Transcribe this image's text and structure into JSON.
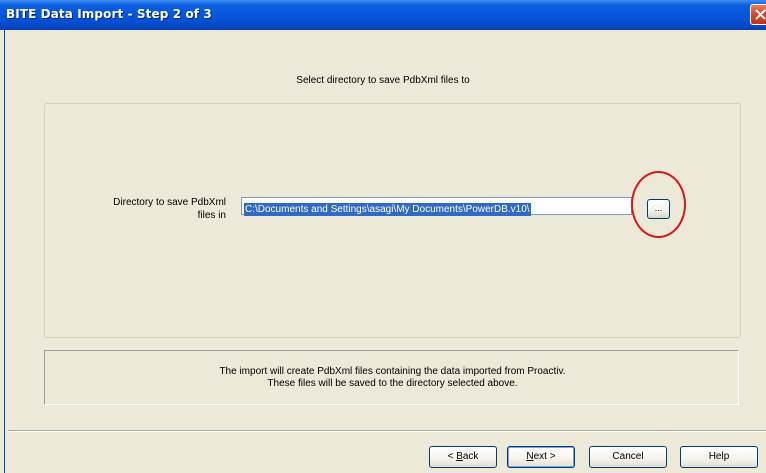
{
  "window": {
    "title": "BITE Data Import - Step 2 of 3"
  },
  "heading": "Select directory to save PdbXml files to",
  "directory": {
    "label_line1": "Directory to save PdbXml",
    "label_line2": "files in",
    "value": "C:\\Documents and Settings\\asagi\\My Documents\\PowerDB.v10\\",
    "browse_label": "..."
  },
  "info": {
    "line1": "The import will create PdbXml files containing the data imported from Proactiv.",
    "line2": "These files will be saved to the directory selected above."
  },
  "buttons": {
    "back_prefix": "< ",
    "back_mnemonic": "B",
    "back_rest": "ack",
    "next_mnemonic": "N",
    "next_rest": "ext >",
    "cancel": "Cancel",
    "help": "Help"
  },
  "colors": {
    "titlebar": "#0555dd",
    "dialog_bg": "#ece9d8",
    "selection": "#316ac5",
    "highlight_circle": "#d9181e",
    "close_button": "#d9442a"
  }
}
